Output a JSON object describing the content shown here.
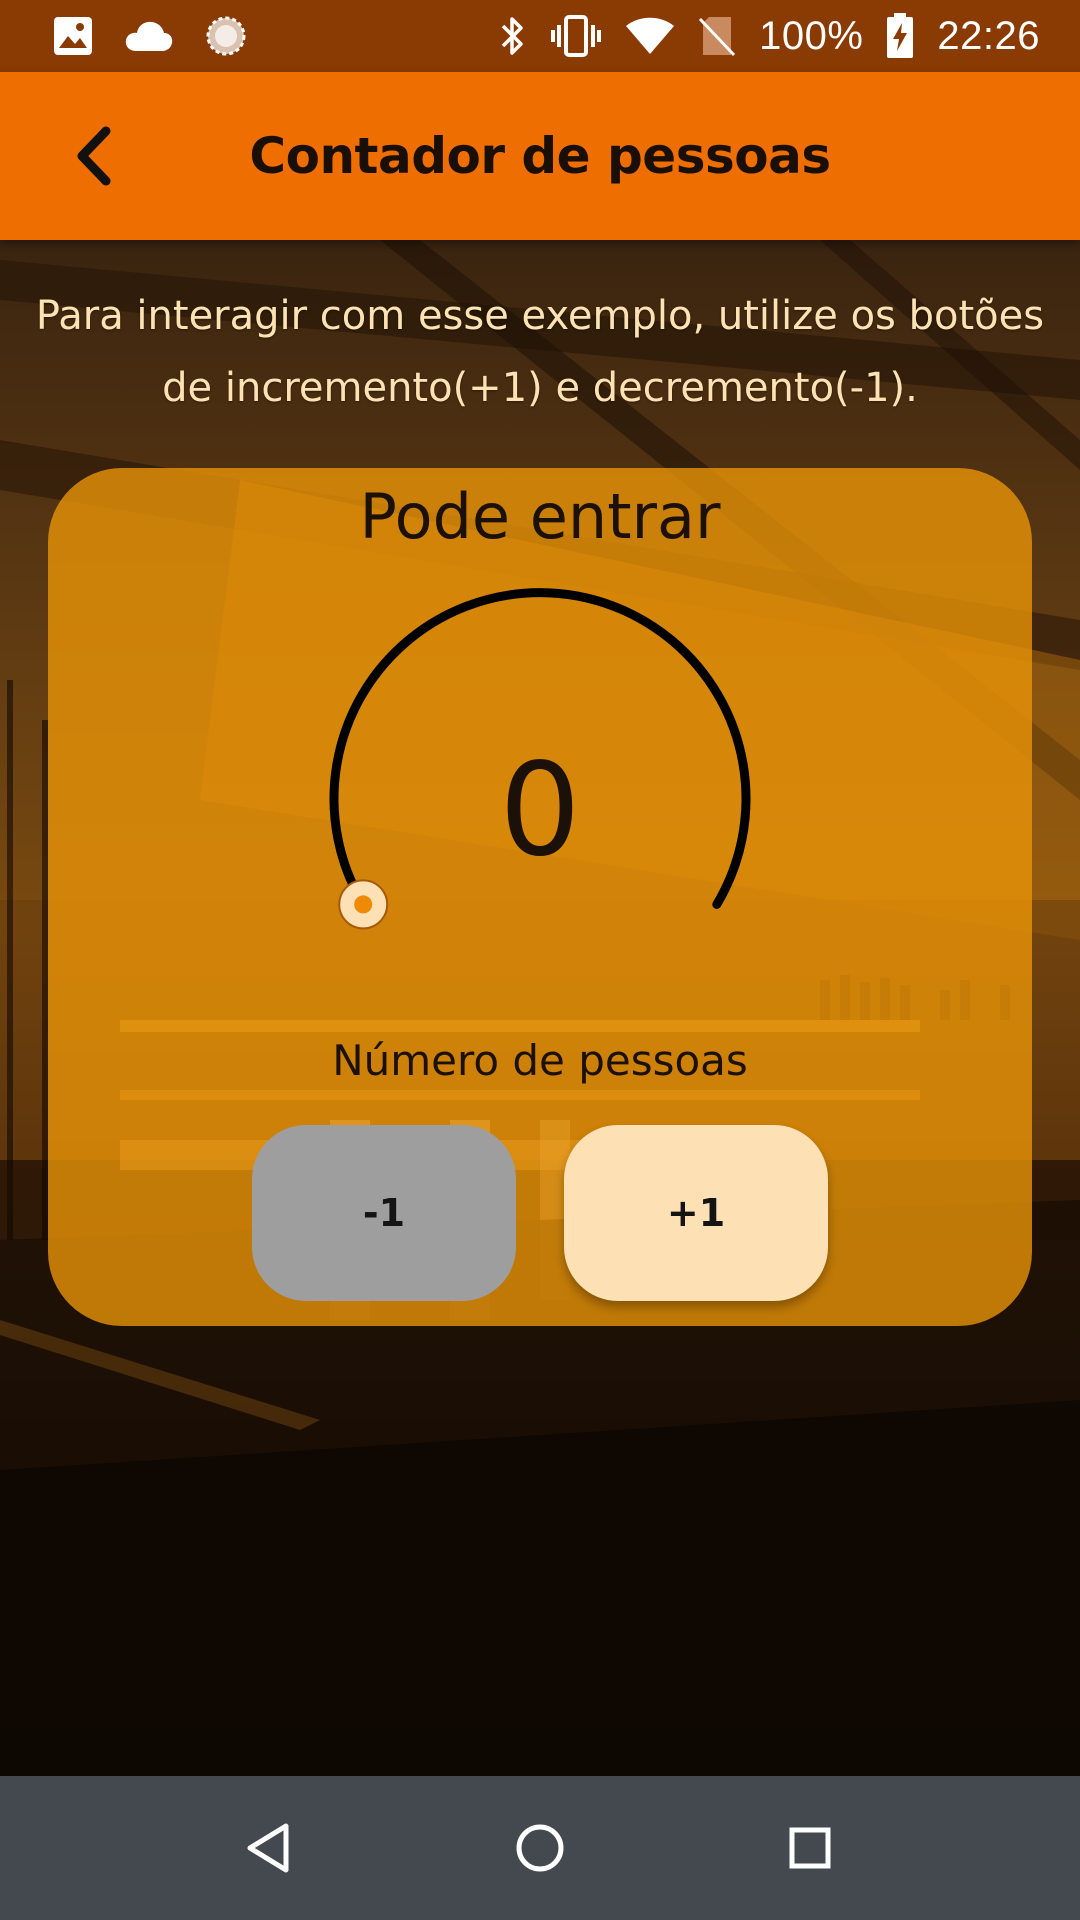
{
  "status_bar": {
    "battery": "100%",
    "time": "22:26",
    "left_icons": [
      "gallery-icon",
      "cloud-icon",
      "sync-progress-icon"
    ],
    "right_icons": [
      "bluetooth-icon",
      "vibrate-icon",
      "wifi-icon",
      "no-sim-icon",
      "battery-charging-icon"
    ]
  },
  "app_bar": {
    "title": "Contador de pessoas",
    "back_icon": "back-arrow-icon"
  },
  "instruction": "Para interagir com esse exemplo, utilize os botões de incremento(+1) e decremento(-1).",
  "counter": {
    "status": "Pode entrar",
    "value": "0",
    "fill_fraction": 0,
    "label": "Número de pessoas",
    "decrement_label": "-1",
    "increment_label": "+1"
  },
  "nav_bar": {
    "icons": [
      "nav-back-icon",
      "nav-home-icon",
      "nav-recents-icon"
    ]
  },
  "colors": {
    "status_bar": "#8a3a03",
    "app_bar": "#ee6e02",
    "card": "#e89408",
    "increment_button": "#fde0b3",
    "decrement_button": "#9e9e9e",
    "instruction_text": "#fde3b4",
    "nav_bar": "#43494f"
  }
}
